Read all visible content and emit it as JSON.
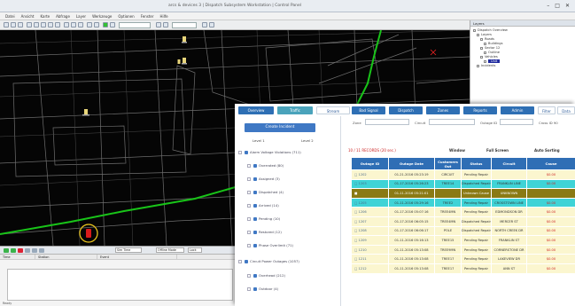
{
  "window": {
    "title": "arcs & devices 3 | Dispatch Subsystem Workstation | Control Panel",
    "controls": [
      "–",
      "□",
      "✕"
    ]
  },
  "menubar": {
    "items": [
      "Datei",
      "Ansicht",
      "Karte",
      "Abfrage",
      "Layer",
      "Werkzeuge",
      "Optionen",
      "Fenster",
      "Hilfe"
    ]
  },
  "tree_panel": {
    "header": "Layers",
    "items": [
      {
        "label": "Dispatch Overview",
        "indent": 0
      },
      {
        "label": "Layers",
        "indent": 1
      },
      {
        "label": "Roads",
        "indent": 2
      },
      {
        "label": "Buildings",
        "indent": 3
      },
      {
        "label": "Sector 12",
        "indent": 2
      },
      {
        "label": "Outline",
        "indent": 3
      },
      {
        "label": "Vehicles",
        "indent": 2
      },
      {
        "label": "Unit",
        "indent": 3,
        "selected": true
      },
      {
        "label": "Incidents",
        "indent": 1
      }
    ]
  },
  "bottom_panel": {
    "field_a": "Sim Time",
    "field_b": "Offline Mode",
    "field_c": "Lock",
    "columns": [
      "Time",
      "Station",
      "Event"
    ],
    "status": "Ready"
  },
  "overlay": {
    "tabs": [
      {
        "label": "Overview",
        "style": "blue"
      },
      {
        "label": "Traffic",
        "style": "teal"
      },
      {
        "label": "Stream",
        "style": "white"
      },
      {
        "label": "Bad Signal",
        "style": "blue"
      },
      {
        "label": "Dispatch",
        "style": "blue"
      },
      {
        "label": "Zones",
        "style": "blue"
      },
      {
        "label": "Reports",
        "style": "blue"
      },
      {
        "label": "Admin",
        "style": "blue"
      },
      {
        "label": "Filter",
        "style": "white"
      },
      {
        "label": "Data",
        "style": "white"
      }
    ],
    "create_button": "Create Incident",
    "levels": [
      "Level 1",
      "Level 2"
    ],
    "filters": [
      {
        "label": "Alarm Voltage Violations (711)",
        "indent": 0
      },
      {
        "label": "Overrated (80)",
        "indent": 1
      },
      {
        "label": "Assigned (3)",
        "indent": 1
      },
      {
        "label": "Dispatched (4)",
        "indent": 1
      },
      {
        "label": "Arrived (14)",
        "indent": 1
      },
      {
        "label": "Pending (10)",
        "indent": 1
      },
      {
        "label": "Restored (12)",
        "indent": 1
      },
      {
        "label": "Phase Overlimit (71)",
        "indent": 1
      },
      {
        "label": "Circuit Power Outages (1057)",
        "indent": 0
      },
      {
        "label": "Overhead (212)",
        "indent": 1
      },
      {
        "label": "Outdoor (4)",
        "indent": 1
      }
    ],
    "search": {
      "label_a": "Zone",
      "label_b": "Circuit",
      "label_c": "Outage ID",
      "label_d": "Cross ID 90"
    },
    "status": {
      "count": "10 / 11 RECORDS (20 sec.)",
      "window": "Window",
      "full_screen": "Full Screen",
      "auto_sort": "Auto Sorting"
    },
    "table": {
      "columns": [
        "Outage ID",
        "Outage Date",
        "Customers Out",
        "Status",
        "Circuit",
        "Cause"
      ],
      "rows": [
        {
          "style": "cream",
          "id": "□ 1202",
          "date": "01-21-2016 05:23:19",
          "cust": "CIRCUIT",
          "status": "Pending Repair",
          "circuit": "",
          "cause": "$0.00"
        },
        {
          "style": "cyan",
          "id": "□ 1203",
          "date": "01-17-2016 05:26:23",
          "cust": "TREE14",
          "status": "Dispatched Repair",
          "circuit": "FRANKLIN LINE",
          "cause": "$0.00"
        },
        {
          "style": "olive",
          "id": "■",
          "date": "01-11-2016 05:21:01",
          "cust": "",
          "status": "Unknown Cause",
          "circuit": "UNKNOWN",
          "cause": ""
        },
        {
          "style": "cyan",
          "id": "□ 1205",
          "date": "01-11-2016 05:29:16",
          "cust": "TREE2",
          "status": "Pending Repair",
          "circuit": "CROSSTOWN LINE",
          "cause": "$0.00"
        },
        {
          "style": "cream",
          "id": "□ 1206",
          "date": "01-17-2016 05:07:16",
          "cust": "TREE4MN",
          "status": "Pending Repair",
          "circuit": "EDMONDSON DR",
          "cause": "$0.00"
        },
        {
          "style": "cream",
          "id": "□ 1207",
          "date": "01-17-2016 06:05:15",
          "cust": "TREE4MN",
          "status": "Dispatched Repair",
          "circuit": "MERCER ST",
          "cause": "$0.00"
        },
        {
          "style": "cream",
          "id": "□ 1208",
          "date": "01-17-2016 06:06:17",
          "cust": "POLE",
          "status": "Dispatched Repair",
          "circuit": "NORTH CREEK DR",
          "cause": "$0.00"
        },
        {
          "style": "cream",
          "id": "□ 1209",
          "date": "01-11-2016 05:16:13",
          "cust": "TREE15",
          "status": "Pending Repair",
          "circuit": "FRANKLIN ST",
          "cause": "$0.00"
        },
        {
          "style": "cream",
          "id": "□ 1210",
          "date": "01-11-2016 05:13:08",
          "cust": "TREE9MN",
          "status": "Pending Repair",
          "circuit": "CORNERSTONE DR",
          "cause": "$0.00"
        },
        {
          "style": "cream",
          "id": "□ 1211",
          "date": "01-11-2016 05:13:08",
          "cust": "TREE17",
          "status": "Pending Repair",
          "circuit": "LAKEVIEW DR",
          "cause": "$0.00"
        },
        {
          "style": "cream",
          "id": "□ 1212",
          "date": "01-11-2016 05:13:08",
          "cust": "TREE17",
          "status": "Pending Repair",
          "circuit": "ANN ST",
          "cause": "$0.00"
        }
      ]
    }
  }
}
